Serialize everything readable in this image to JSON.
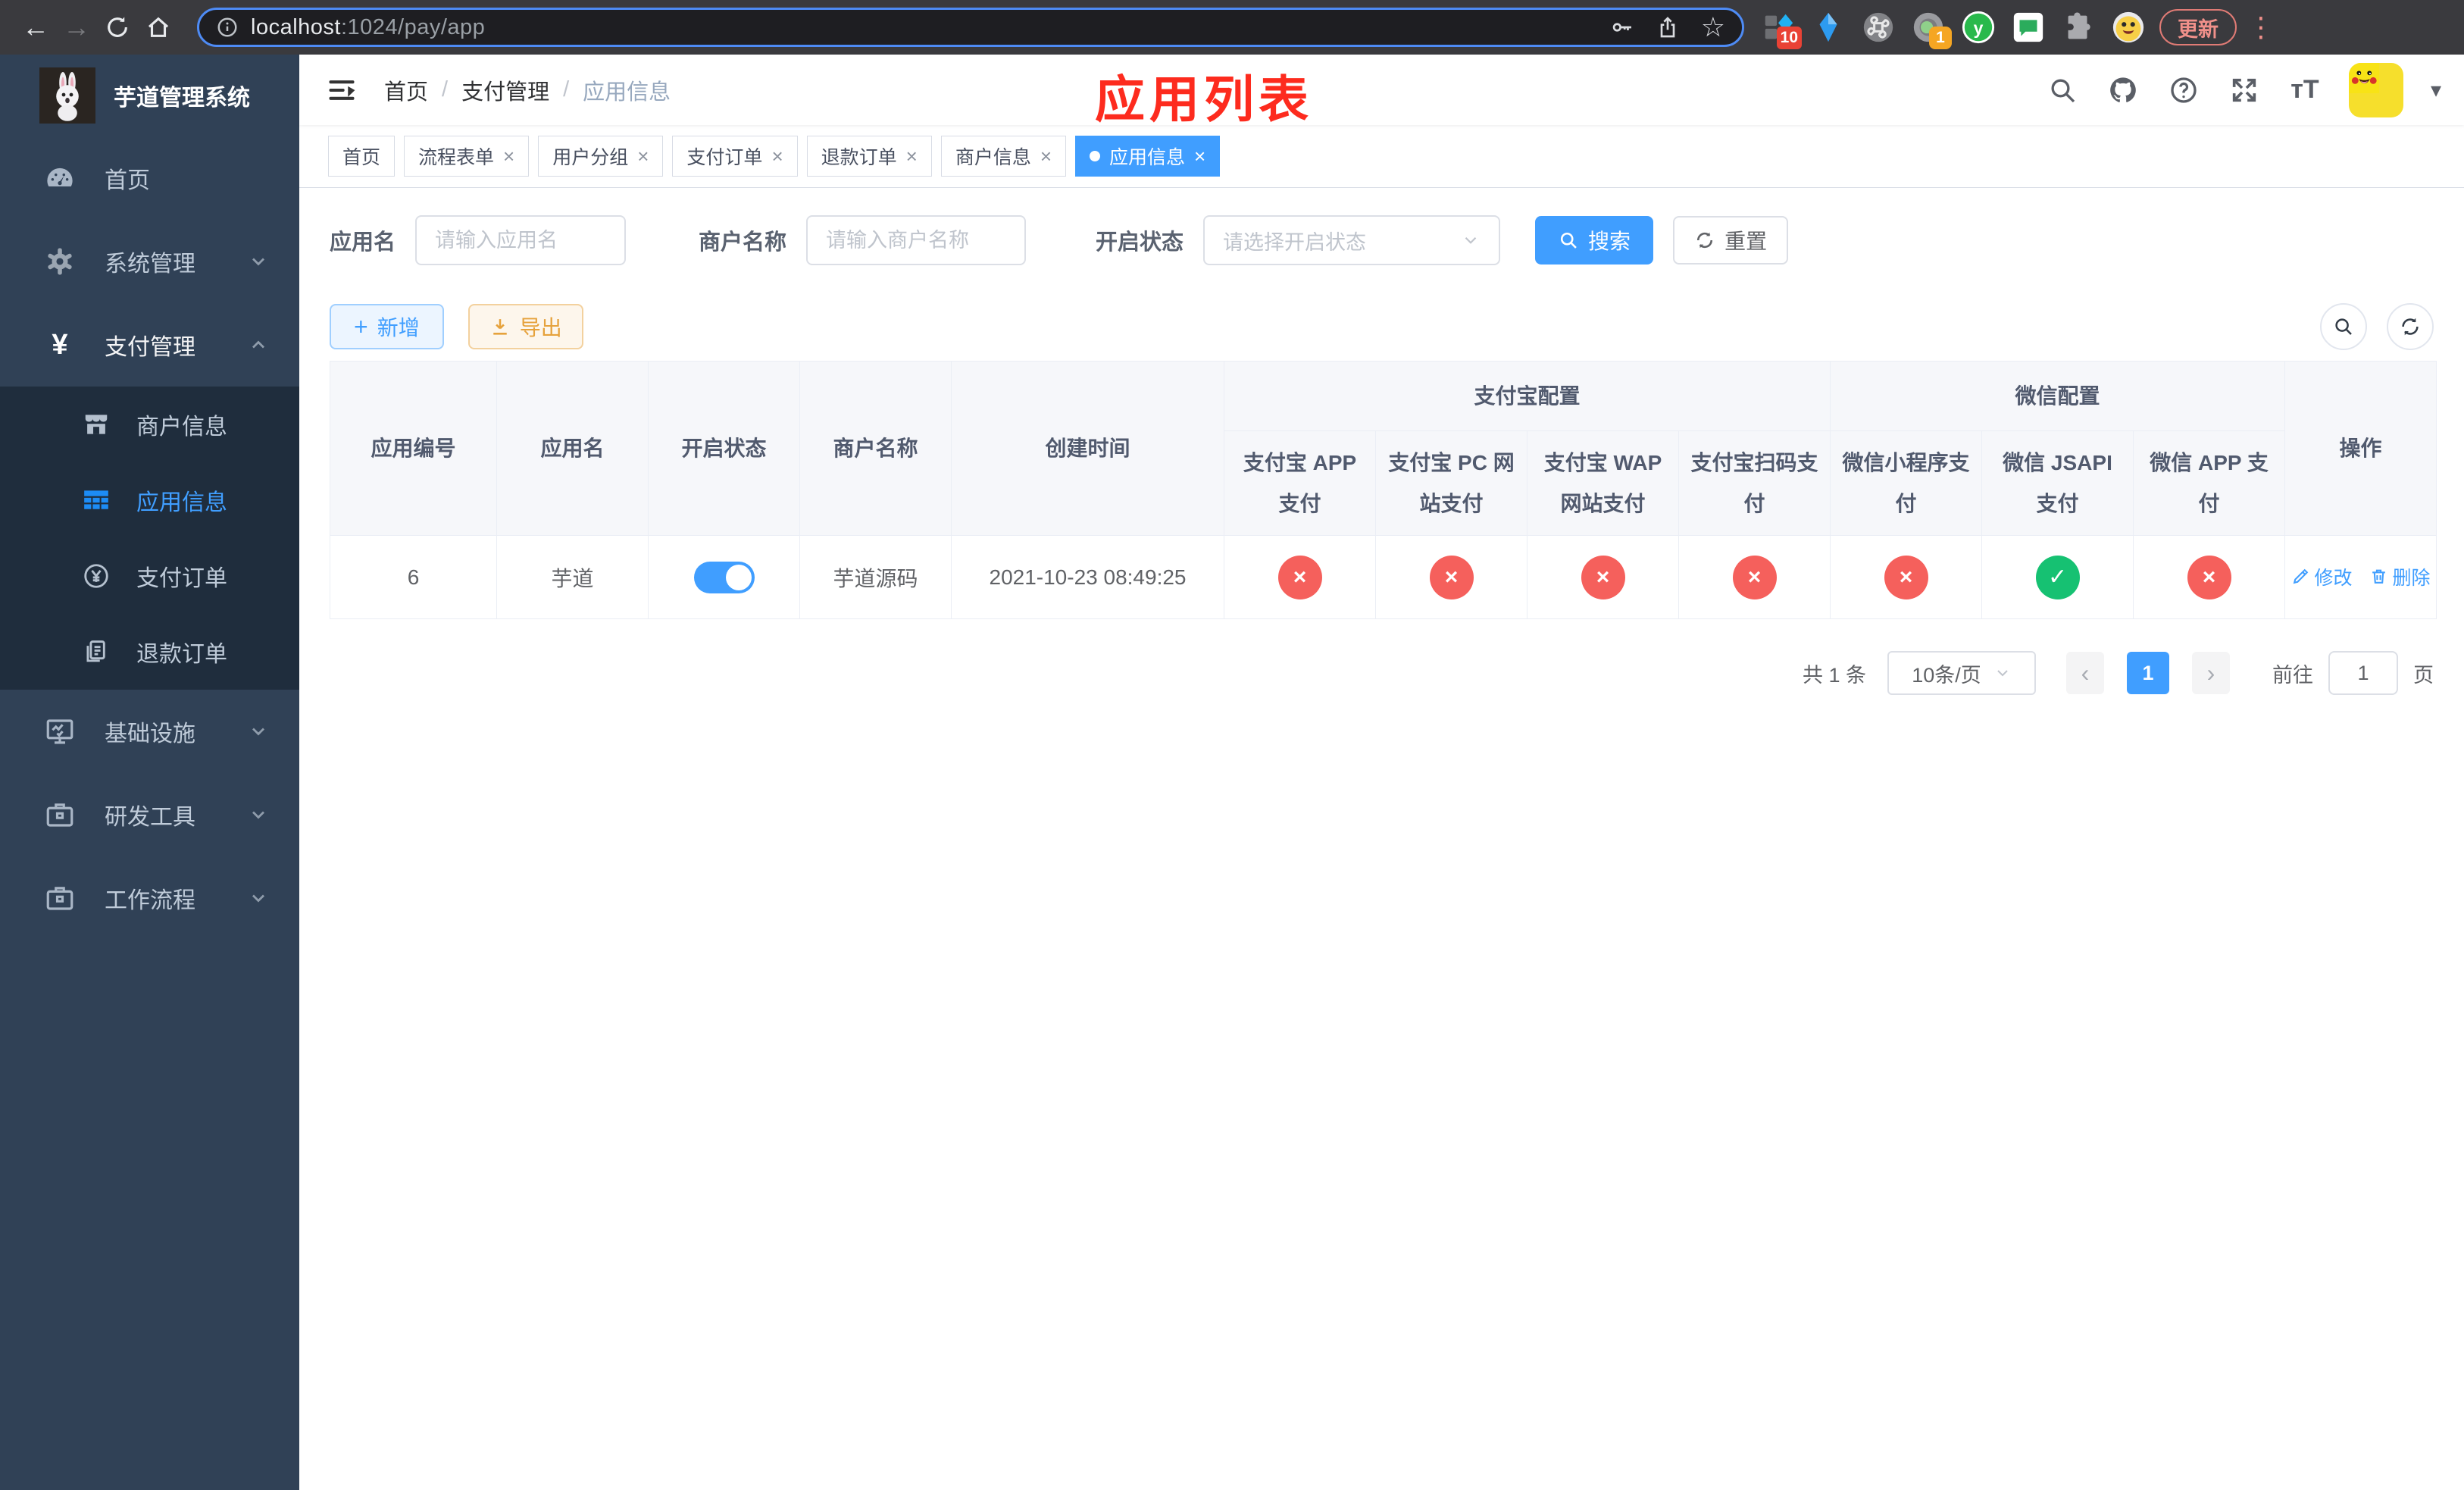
{
  "browser": {
    "url_host": "localhost",
    "url_rest": ":1024/pay/app",
    "update_label": "更新",
    "ext_badge_grid": "10",
    "ext_badge_record": "1",
    "ext_y_letter": "y"
  },
  "sidebar": {
    "title": "芋道管理系统",
    "items": [
      {
        "label": "首页"
      },
      {
        "label": "系统管理"
      },
      {
        "label": "支付管理"
      },
      {
        "label": "商户信息"
      },
      {
        "label": "应用信息"
      },
      {
        "label": "支付订单"
      },
      {
        "label": "退款订单"
      },
      {
        "label": "基础设施"
      },
      {
        "label": "研发工具"
      },
      {
        "label": "工作流程"
      }
    ]
  },
  "header": {
    "breadcrumb": {
      "home": "首页",
      "section": "支付管理",
      "page": "应用信息"
    },
    "annotation": "应用列表"
  },
  "tabs": {
    "items": [
      {
        "label": "首页",
        "closable": false,
        "active": false
      },
      {
        "label": "流程表单",
        "closable": true,
        "active": false
      },
      {
        "label": "用户分组",
        "closable": true,
        "active": false
      },
      {
        "label": "支付订单",
        "closable": true,
        "active": false
      },
      {
        "label": "退款订单",
        "closable": true,
        "active": false
      },
      {
        "label": "商户信息",
        "closable": true,
        "active": false
      },
      {
        "label": "应用信息",
        "closable": true,
        "active": true
      }
    ]
  },
  "filters": {
    "app_name": {
      "label": "应用名",
      "placeholder": "请输入应用名",
      "value": ""
    },
    "merchant_name": {
      "label": "商户名称",
      "placeholder": "请输入商户名称",
      "value": ""
    },
    "status": {
      "label": "开启状态",
      "placeholder": "请选择开启状态"
    },
    "search_label": "搜索",
    "reset_label": "重置"
  },
  "toolbar": {
    "add_label": "新增",
    "export_label": "导出"
  },
  "table": {
    "headers": {
      "app_id": "应用编号",
      "app_name": "应用名",
      "status": "开启状态",
      "merchant": "商户名称",
      "created": "创建时间",
      "alipay_group": "支付宝配置",
      "wechat_group": "微信配置",
      "actions": "操作",
      "channels": [
        "支付宝 APP 支付",
        "支付宝 PC 网站支付",
        "支付宝 WAP 网站支付",
        "支付宝扫码支付",
        "微信小程序支付",
        "微信 JSAPI 支付",
        "微信 APP 支付"
      ]
    },
    "row": {
      "app_id": "6",
      "app_name": "芋道",
      "status_on": true,
      "merchant": "芋道源码",
      "created": "2021-10-23 08:49:25",
      "channel_status": [
        false,
        false,
        false,
        false,
        false,
        true,
        false
      ],
      "edit_label": "修改",
      "delete_label": "删除"
    }
  },
  "pagination": {
    "total": "共 1 条",
    "page_size": "10条/页",
    "current_page": "1",
    "goto_prefix": "前往",
    "goto_value": "1",
    "goto_suffix": "页"
  },
  "colors": {
    "accent": "#409eff",
    "success": "#16c172",
    "danger": "#f5605c",
    "warning": "#e6a23c",
    "sidebar_bg": "#304156",
    "submenu_bg": "#1f2d3d",
    "annotation_red": "#fd2b1e"
  }
}
